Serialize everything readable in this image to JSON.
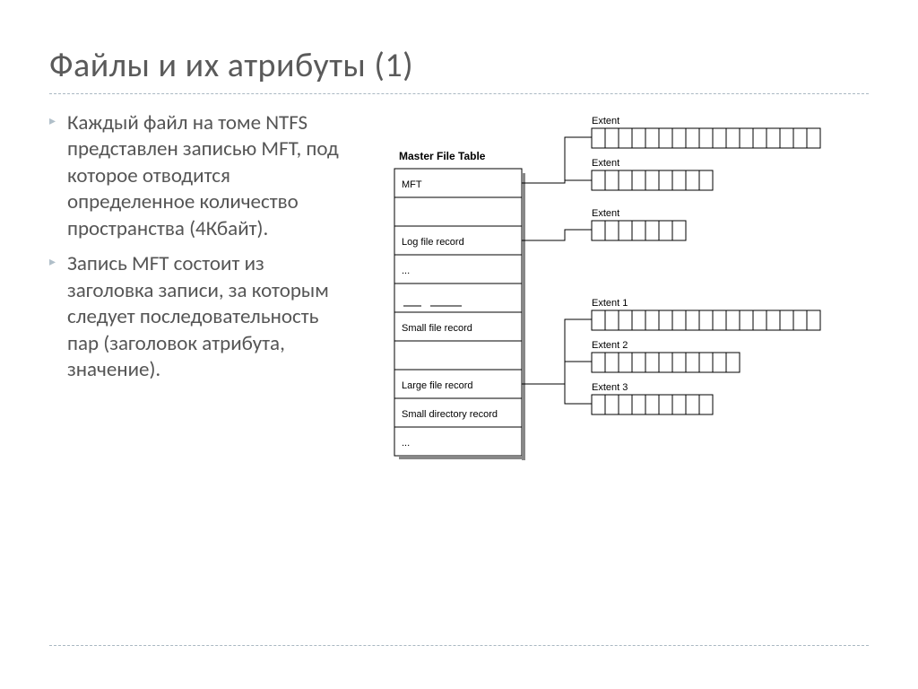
{
  "title": "Файлы и их атрибуты (1)",
  "bullets": [
    "Каждый файл на томе NTFS представлен записью MFT, под которое отводится определенное количество пространства (4Кбайт).",
    "Запись MFT состоит из заголовка записи, за которым следует последовательность пар (заголовок атрибута, значение)."
  ],
  "diagram": {
    "mft_title": "Master File Table",
    "rows": {
      "r1": "MFT",
      "r3": "Log file record",
      "r4": "...",
      "r6": "Small file record",
      "r8": "Large file record",
      "r9": "Small directory record",
      "r10": "..."
    },
    "extents": {
      "e1_label": "Extent",
      "e1_cells": 17,
      "e2_label": "Extent",
      "e2_cells": 9,
      "e3_label": "Extent",
      "e3_cells": 7,
      "e4_label": "Extent 1",
      "e4_cells": 17,
      "e5_label": "Extent 2",
      "e5_cells": 11,
      "e6_label": "Extent 3",
      "e6_cells": 9
    }
  }
}
